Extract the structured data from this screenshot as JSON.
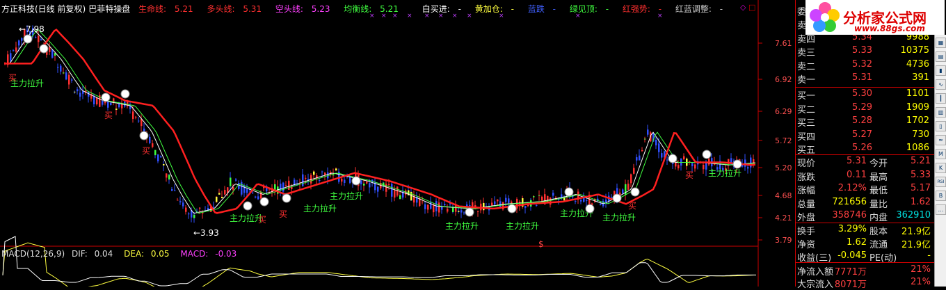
{
  "title_bar": {
    "name": "方正科技(日线 前复权)",
    "indicator": "巴菲特操盘",
    "lifeline_label": "生命线:",
    "lifeline_value": "5.21",
    "bull_label": "多头线:",
    "bull_value": "5.31",
    "bear_label": "空头线:",
    "bear_value": "5.23",
    "balance_label": "均衡线:",
    "balance_value": "5.21",
    "buy_label": "白买进:",
    "buy_value": "-",
    "yellow_label": "黄加仓:",
    "yellow_value": "-",
    "blue_label": "蓝跌",
    "blue_value": "-",
    "green_label": "绿见顶:",
    "green_value": "-",
    "red_label": "红强势:",
    "red_value": "-",
    "adjust_label": "红蓝调整:",
    "adjust_value": "-"
  },
  "y_axis": [
    "7.61",
    "6.92",
    "6.29",
    "5.72",
    "5.20",
    "4.68",
    "4.21",
    "3.79"
  ],
  "price_marks": {
    "high": "7.98",
    "low": "3.93"
  },
  "chart_texts": {
    "lift": "主力拉升",
    "buy": "买",
    "lift_buy": "主力拉升买"
  },
  "macd": {
    "label": "MACD(12,26,9)",
    "dif_label": "DIF:",
    "dif_value": "0.04",
    "dea_label": "DEA:",
    "dea_value": "0.05",
    "macd_label": "MACD:",
    "macd_value": "-0.03"
  },
  "logo": {
    "text": "分析家公式网",
    "url": "www.88gs.com"
  },
  "order_book": {
    "wei_label": "委",
    "sell": [
      {
        "label": "卖",
        "price": "",
        "vol": ""
      },
      {
        "label": "卖四",
        "price": "5.34",
        "vol": "9988"
      },
      {
        "label": "卖三",
        "price": "5.33",
        "vol": "10375"
      },
      {
        "label": "卖二",
        "price": "5.32",
        "vol": "4736"
      },
      {
        "label": "卖一",
        "price": "5.31",
        "vol": "391"
      }
    ],
    "buy": [
      {
        "label": "买一",
        "price": "5.30",
        "vol": "1101"
      },
      {
        "label": "买二",
        "price": "5.29",
        "vol": "1909"
      },
      {
        "label": "买三",
        "price": "5.28",
        "vol": "1702"
      },
      {
        "label": "买四",
        "price": "5.27",
        "vol": "730"
      },
      {
        "label": "买五",
        "price": "5.26",
        "vol": "1086"
      }
    ]
  },
  "quote": [
    {
      "l1": "现价",
      "v1": "5.31",
      "l2": "今开",
      "v2": "5.21"
    },
    {
      "l1": "涨跌",
      "v1": "0.11",
      "l2": "最高",
      "v2": "5.33"
    },
    {
      "l1": "涨幅",
      "v1": "2.12%",
      "l2": "最低",
      "v2": "5.17"
    },
    {
      "l1": "总量",
      "v1": "721656",
      "l2": "量比",
      "v2": "1.62"
    },
    {
      "l1": "外盘",
      "v1": "358746",
      "l2": "内盘",
      "v2": "362910"
    }
  ],
  "fundamentals": [
    {
      "l1": "换手",
      "v1": "3.29%",
      "l2": "股本",
      "v2": "21.9亿"
    },
    {
      "l1": "净资",
      "v1": "1.62",
      "l2": "流通",
      "v2": "21.9亿"
    },
    {
      "l1": "收益(三)",
      "v1": "-0.045",
      "l2": "PE(动)",
      "v2": "-"
    }
  ],
  "flow": [
    {
      "l1": "净流入额",
      "v1": "7771万",
      "v2": "21%"
    },
    {
      "l1": "大宗流入",
      "v1": "8071万",
      "v2": "21%"
    }
  ],
  "toolbar_buttons": [
    "chart-icon",
    "grid-icon",
    "bar-icon",
    "line-icon",
    "candle-icon",
    "table-icon",
    "volume-icon",
    "ma-icon",
    "macd-icon",
    "kdj-icon",
    "rsi-icon",
    "boll-icon",
    "more-icon"
  ],
  "colors": {
    "lifeline": "#ff3030",
    "bull": "#ff3030",
    "bear": "#ff40ff",
    "balance": "#40ff40",
    "up": "#ff3030",
    "down": "#4040ff",
    "axis": "#c00000"
  }
}
